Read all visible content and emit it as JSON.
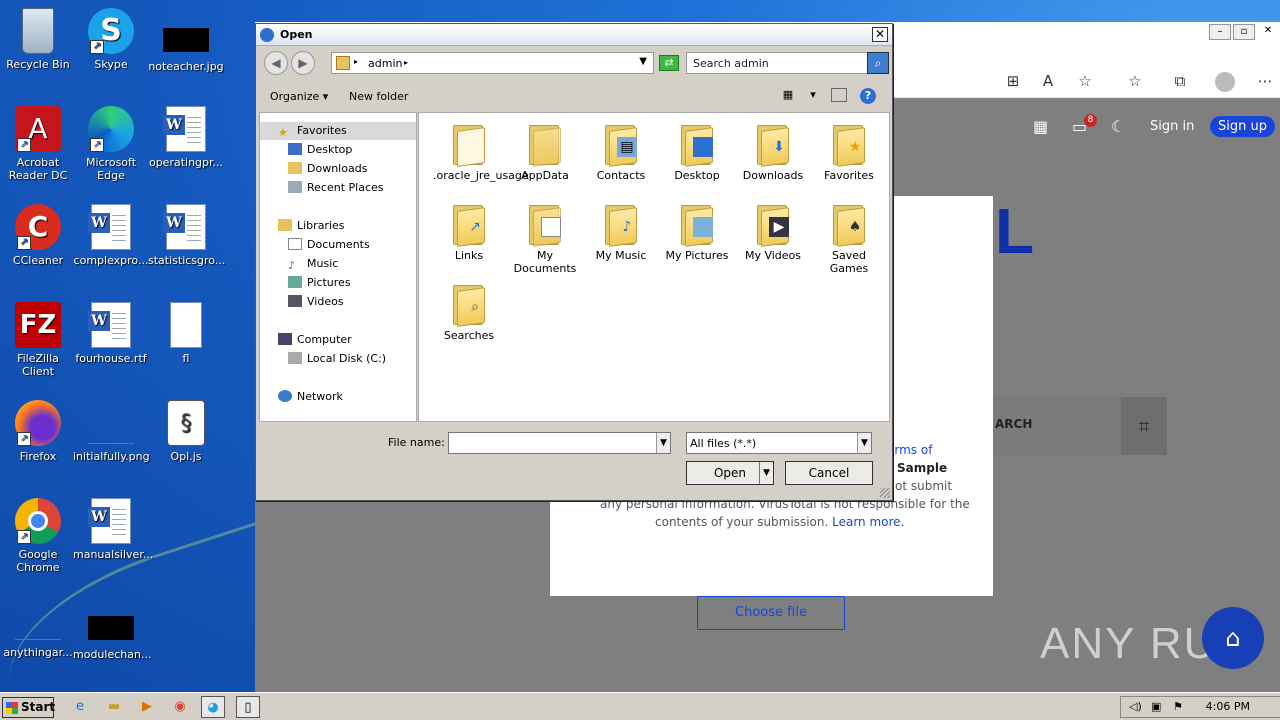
{
  "desktop": {
    "icons": [
      {
        "label": "Recycle Bin",
        "icon": "recycle-bin-icon"
      },
      {
        "label": "Skype",
        "icon": "skype-icon"
      },
      {
        "label": "noteacher.jpg",
        "icon": "image-file-icon"
      },
      {
        "label": "Acrobat Reader DC",
        "icon": "acrobat-icon"
      },
      {
        "label": "Microsoft Edge",
        "icon": "edge-icon"
      },
      {
        "label": "operatingpr...",
        "icon": "word-doc-icon"
      },
      {
        "label": "CCleaner",
        "icon": "ccleaner-icon"
      },
      {
        "label": "complexpro...",
        "icon": "word-doc-icon"
      },
      {
        "label": "statisticsgro...",
        "icon": "word-doc-icon"
      },
      {
        "label": "FileZilla Client",
        "icon": "filezilla-icon"
      },
      {
        "label": "fourhouse.rtf",
        "icon": "word-doc-icon"
      },
      {
        "label": "fl",
        "icon": "blank-file-icon"
      },
      {
        "label": "Firefox",
        "icon": "firefox-icon"
      },
      {
        "label": "initialfully.png",
        "icon": "image-file-icon"
      },
      {
        "label": "Opl.js",
        "icon": "script-file-icon"
      },
      {
        "label": "Google Chrome",
        "icon": "chrome-icon"
      },
      {
        "label": "manualsilver...",
        "icon": "word-doc-icon"
      },
      {
        "label": "anythingar...",
        "icon": "image-file-icon"
      },
      {
        "label": "modulechan...",
        "icon": "image-file-icon"
      }
    ]
  },
  "browser": {
    "signin": "Sign in",
    "signup": "Sign up",
    "notif_count": "8",
    "big_letter": "L",
    "search_label": "ARCH",
    "terms_fragment": "erms of",
    "sample_fragment": "Sample",
    "submit_fragment": "ot submit",
    "line3": "any personal information. VirusTotal is not responsible for the",
    "line4": "contents of your submission.",
    "learn_more": "Learn more.",
    "choose_file": "Choose file",
    "watermark": "ANY RUN"
  },
  "dialog": {
    "title": "Open",
    "address": "admin",
    "search_placeholder": "Search admin",
    "organize": "Organize",
    "new_folder": "New folder",
    "nav": {
      "favorites": "Favorites",
      "desktop": "Desktop",
      "downloads": "Downloads",
      "recent": "Recent Places",
      "libraries": "Libraries",
      "documents": "Documents",
      "music": "Music",
      "pictures": "Pictures",
      "videos": "Videos",
      "computer": "Computer",
      "local_disk": "Local Disk (C:)",
      "network": "Network"
    },
    "files": [
      {
        "label": ".oracle_jre_usage",
        "icon": "folder-icon"
      },
      {
        "label": "AppData",
        "icon": "folder-icon"
      },
      {
        "label": "Contacts",
        "icon": "contacts-folder-icon"
      },
      {
        "label": "Desktop",
        "icon": "desktop-folder-icon"
      },
      {
        "label": "Downloads",
        "icon": "downloads-folder-icon"
      },
      {
        "label": "Favorites",
        "icon": "favorites-folder-icon"
      },
      {
        "label": "Links",
        "icon": "links-folder-icon"
      },
      {
        "label": "My Documents",
        "icon": "documents-folder-icon"
      },
      {
        "label": "My Music",
        "icon": "music-folder-icon"
      },
      {
        "label": "My Pictures",
        "icon": "pictures-folder-icon"
      },
      {
        "label": "My Videos",
        "icon": "videos-folder-icon"
      },
      {
        "label": "Saved Games",
        "icon": "games-folder-icon"
      },
      {
        "label": "Searches",
        "icon": "searches-folder-icon"
      }
    ],
    "file_name_label": "File name:",
    "file_name_value": "",
    "file_type": "All files (*.*)",
    "open": "Open",
    "cancel": "Cancel"
  },
  "taskbar": {
    "start": "Start",
    "time": "4:06 PM"
  }
}
